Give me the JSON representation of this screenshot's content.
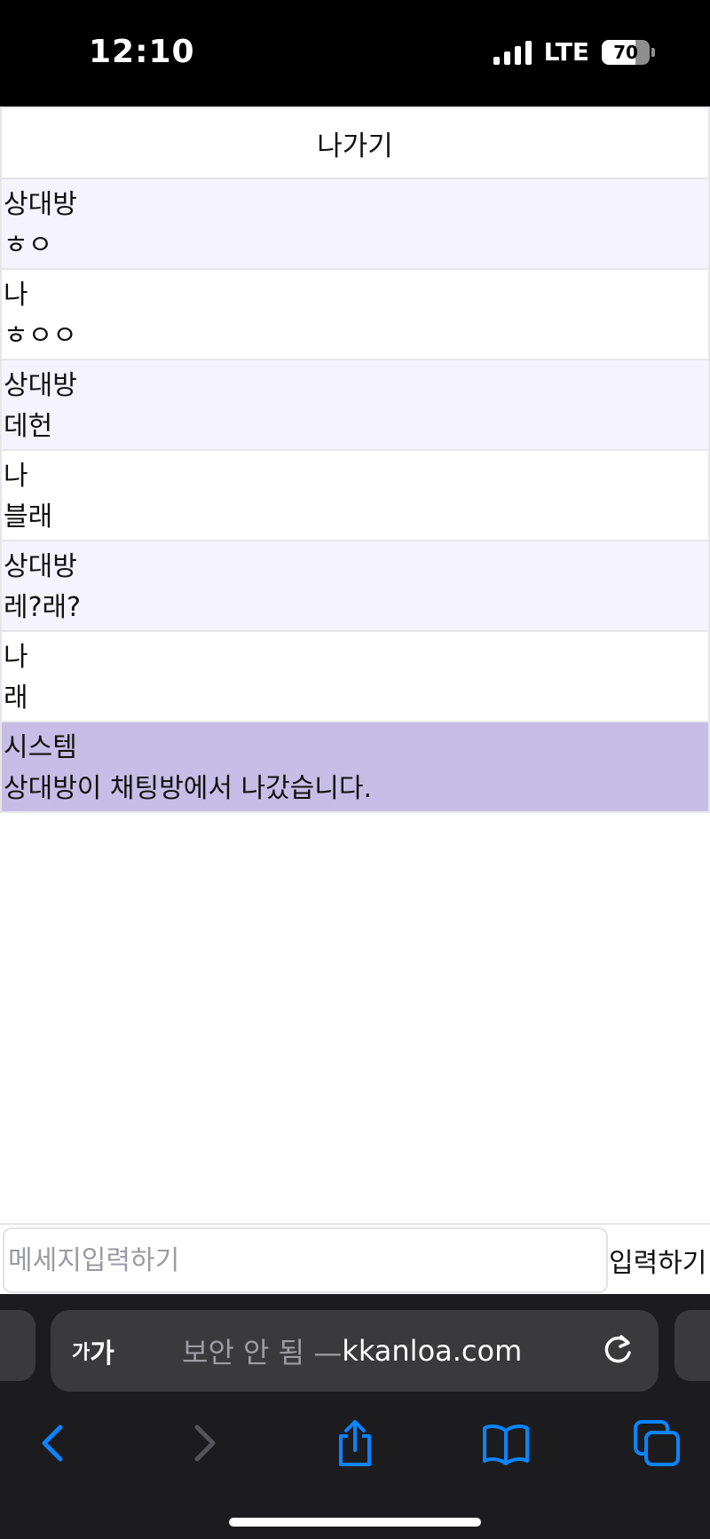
{
  "status_bar": {
    "time": "12:10",
    "network": "LTE",
    "battery": "70"
  },
  "chat": {
    "exit_label": "나가기",
    "messages": [
      {
        "sender": "상대방",
        "text": "ㅎㅇ",
        "kind": "other"
      },
      {
        "sender": "나",
        "text": "ㅎㅇㅇ",
        "kind": "mine"
      },
      {
        "sender": "상대방",
        "text": "데헌",
        "kind": "other"
      },
      {
        "sender": "나",
        "text": "블래",
        "kind": "mine"
      },
      {
        "sender": "상대방",
        "text": "레?래?",
        "kind": "other"
      },
      {
        "sender": "나",
        "text": "래",
        "kind": "mine"
      },
      {
        "sender": "시스템",
        "text": "상대방이 채팅방에서 나갔습니다.",
        "kind": "system"
      }
    ],
    "input_placeholder": "메세지입력하기",
    "input_value": "",
    "send_label": "입력하기"
  },
  "browser": {
    "aa_small": "가",
    "aa_large": "가",
    "url_prefix": "보안 안 됨 — ",
    "url_domain": "kkanloa.com"
  },
  "colors": {
    "other_bg": "#f4f3fe",
    "mine_bg": "#ffffff",
    "system_bg": "#c6bee6",
    "accent_blue": "#0a84ff"
  },
  "icons": {
    "reload": "reload-icon",
    "back": "chevron-left-icon",
    "forward": "chevron-right-icon",
    "share": "share-icon",
    "bookmarks": "book-icon",
    "tabs": "tabs-icon"
  }
}
